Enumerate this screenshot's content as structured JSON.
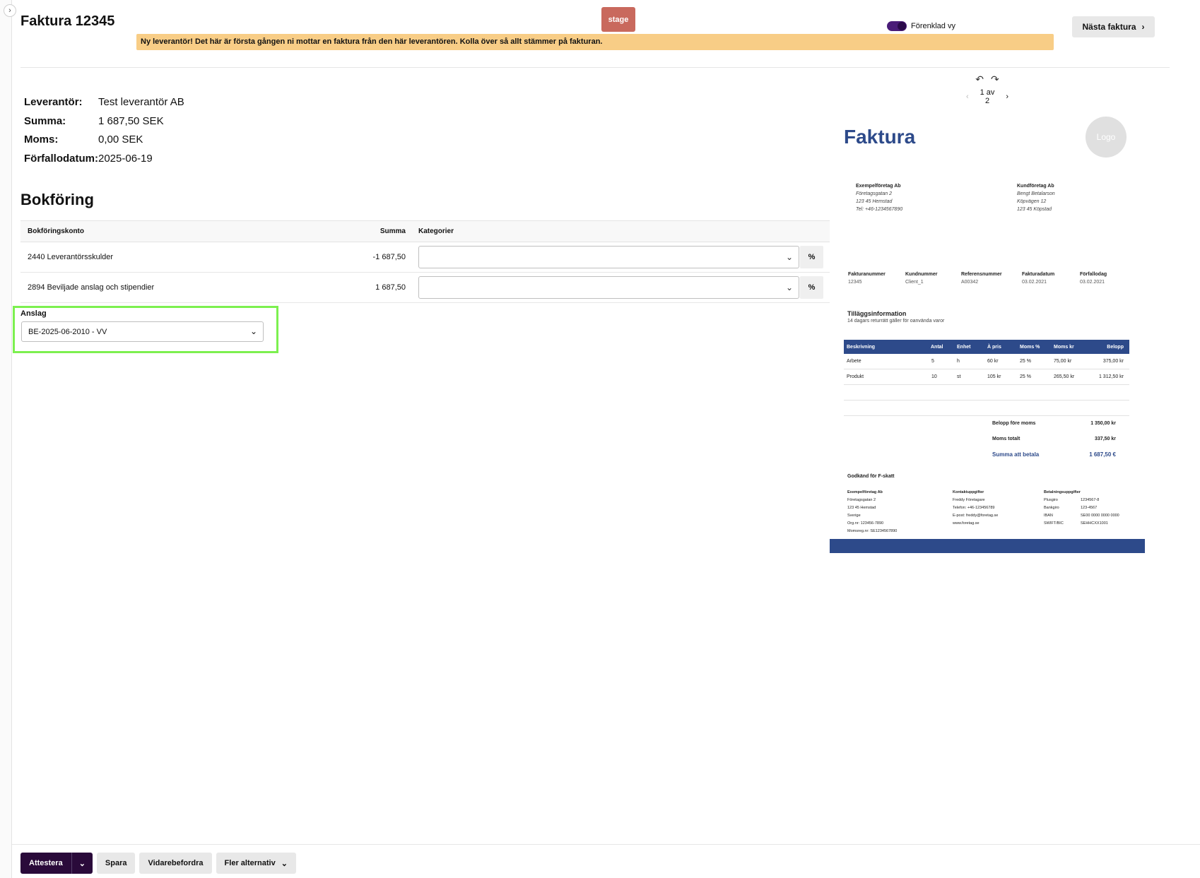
{
  "header": {
    "title": "Faktura 12345",
    "stage_badge": "stage",
    "simple_view_label": "Förenklad vy",
    "next_invoice_label": "Nästa faktura",
    "alert": "Ny leverantör! Det här är första gången ni mottar en faktura från den här leverantören. Kolla över så allt stämmer på fakturan."
  },
  "summary": [
    {
      "key": "Leverantör:",
      "value": "Test leverantör AB"
    },
    {
      "key": "Summa:",
      "value": "1 687,50 SEK"
    },
    {
      "key": "Moms:",
      "value": "0,00 SEK"
    },
    {
      "key": "Förfallodatum:",
      "value": "2025-06-19"
    }
  ],
  "bokforing": {
    "title": "Bokföring",
    "columns": {
      "konto": "Bokföringskonto",
      "summa": "Summa",
      "kategorier": "Kategorier"
    },
    "rows": [
      {
        "konto": "2440 Leverantörsskulder",
        "summa": "-1 687,50",
        "pct": "%"
      },
      {
        "konto": "2894 Beviljade anslag och stipendier",
        "summa": "1 687,50",
        "pct": "%"
      }
    ]
  },
  "anslag": {
    "label": "Anslag",
    "selected": "BE-2025-06-2010 - VV"
  },
  "viewer": {
    "page_indicator": "1 av 2"
  },
  "invoice": {
    "title": "Faktura",
    "logo": "Logo",
    "seller": {
      "name": "Exempelföretag Ab",
      "lines": [
        "Företagsgatan 2",
        "123 45 Hemstad",
        "Tel: +46-1234567890"
      ]
    },
    "buyer": {
      "name": "Kundföretag Ab",
      "lines": [
        "Bengt Betalarson",
        "Köpvägen 12",
        "123 45 Köpstad"
      ]
    },
    "meta": [
      {
        "k": "Fakturanummer",
        "v": "12345"
      },
      {
        "k": "Kundnummer",
        "v": "Client_1"
      },
      {
        "k": "Referensnummer",
        "v": "A00342"
      },
      {
        "k": "Fakturadatum",
        "v": "03.02.2021"
      },
      {
        "k": "Förfallodag",
        "v": "03.02.2021"
      }
    ],
    "extra_title": "Tilläggsinformation",
    "extra_text": "14 dagars returrätt gäller för oanvända varor",
    "line_headers": [
      "Beskrivning",
      "Antal",
      "Enhet",
      "À pris",
      "Moms %",
      "Moms kr",
      "Belopp"
    ],
    "lines": [
      [
        "Arbete",
        "5",
        "h",
        "60 kr",
        "25 %",
        "75,00 kr",
        "375,00 kr"
      ],
      [
        "Produkt",
        "10",
        "st",
        "105 kr",
        "25 %",
        "265,50 kr",
        "1 312,50 kr"
      ]
    ],
    "totals": [
      {
        "k": "Belopp före moms",
        "v": "1 350,00 kr"
      },
      {
        "k": "Moms totalt",
        "v": "337,50 kr"
      },
      {
        "k": "Summa att betala",
        "v": "1 687,50 €"
      }
    ],
    "f_skatt": "Godkänd för F-skatt",
    "footer_cols": [
      {
        "title": "Exempelföretag Ab",
        "lines": [
          "Företagsgatan 2",
          "123 45 Hemstad",
          "Sverige",
          "Org.nr: 123456-7890",
          "Momsreg.nr: SE1234567890"
        ]
      },
      {
        "title": "Kontaktuppgifter",
        "lines": [
          "Freddy Företagare",
          "Telefon: +46-123456789",
          "E-post: freddy@foretag.se",
          "www.foretag.se"
        ]
      },
      {
        "title": "Betalningsuppgifter",
        "lines": [
          "Plusgiro",
          "Bankgiro",
          "IBAN",
          "SWIFT/BIC"
        ]
      },
      {
        "title": "",
        "lines": [
          "1234567-8",
          "123-4567",
          "SE00 0000 0000 0000",
          "SEHHCXX1001"
        ]
      }
    ]
  },
  "actions": {
    "attest": "Attestera",
    "save": "Spara",
    "forward": "Vidarebefordra",
    "more": "Fler alternativ"
  }
}
